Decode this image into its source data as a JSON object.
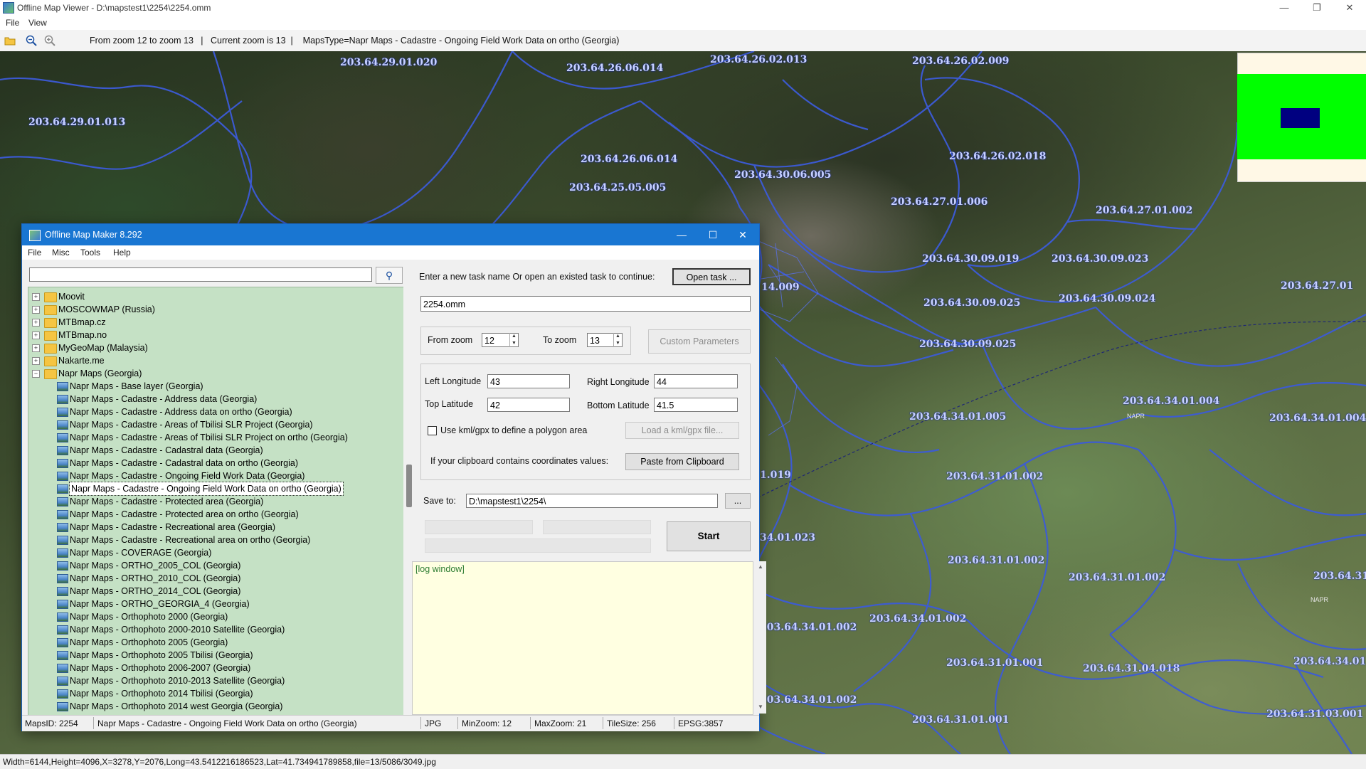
{
  "viewer": {
    "title": "Offline Map Viewer - D:\\mapstest1\\2254\\2254.omm",
    "menu": [
      "File",
      "View"
    ],
    "toolbar_info": "From zoom 12 to zoom 13   |   Current zoom is 13  |    MapsType=Napr Maps - Cadastre - Ongoing Field Work Data on ortho (Georgia)",
    "status": "Width=6144,Height=4096,X=3278,Y=2076,Long=43.5412216186523,Lat=41.734941789858,file=13/5086/3049.jpg",
    "window_controls": [
      "minimize",
      "restore",
      "close"
    ]
  },
  "map": {
    "labels": [
      "203.64.29.01.020",
      "203.64.26.06.014",
      "203.64.26.02.013",
      "203.64.26.02.009",
      "203.64.29.01.013",
      "203.64.26.06.014",
      "203.64.26.02.018",
      "203.64.25.05.005",
      "203.64.30.06.005",
      "203.64.27.01.006",
      "203.64.27.01.002",
      "203.64.30.09.019",
      "203.64.30.09.023",
      "14.009",
      "203.64.27.01",
      "203.64.30.09.025",
      "203.64.30.09.024",
      "203.64.30.09.025",
      "203.64.34.01.004",
      "203.64.34.01.005",
      "203.64.34.01.004",
      "1.019",
      "203.64.31.01.002",
      "34.01.023",
      "203.64.31.01.002",
      "203.64.31.01.002",
      "203.64.31",
      "203.64.34.01.002",
      "203.64.34.01.002",
      "203.64.31.01.001",
      "203.64.31.04.018",
      "203.64.34.01",
      "203.64.34.01.002",
      "203.64.31.01.001",
      "203.64.31.03.001"
    ],
    "small_labels": [
      "NAPR",
      "NAPR"
    ]
  },
  "minimap": {
    "bg": "#fff8e6",
    "area": "#00ff00",
    "view": "#000080"
  },
  "dialog": {
    "title": "Offline Map Maker 8.292",
    "menu": [
      "File",
      "Misc",
      "Tools",
      "Help"
    ],
    "search": {
      "value": "",
      "placeholder": ""
    },
    "tree": [
      {
        "label": "Moovit",
        "type": "folder",
        "expanded": false
      },
      {
        "label": "MOSCOWMAP (Russia)",
        "type": "folder",
        "expanded": false
      },
      {
        "label": "MTBmap.cz",
        "type": "folder",
        "expanded": false
      },
      {
        "label": "MTBmap.no",
        "type": "folder",
        "expanded": false
      },
      {
        "label": "MyGeoMap (Malaysia)",
        "type": "folder",
        "expanded": false
      },
      {
        "label": "Nakarte.me",
        "type": "folder",
        "expanded": false
      },
      {
        "label": "Napr Maps (Georgia)",
        "type": "folder",
        "expanded": true
      },
      {
        "label": "Napr Maps - Base layer (Georgia)",
        "type": "map"
      },
      {
        "label": "Napr Maps - Cadastre - Address data (Georgia)",
        "type": "map"
      },
      {
        "label": "Napr Maps - Cadastre - Address data on ortho (Georgia)",
        "type": "map"
      },
      {
        "label": "Napr Maps - Cadastre - Areas of Tbilisi SLR Project (Georgia)",
        "type": "map"
      },
      {
        "label": "Napr Maps - Cadastre - Areas of Tbilisi SLR Project on ortho (Georgia)",
        "type": "map"
      },
      {
        "label": "Napr Maps - Cadastre - Cadastral data (Georgia)",
        "type": "map"
      },
      {
        "label": "Napr Maps - Cadastre - Cadastral data on ortho (Georgia)",
        "type": "map"
      },
      {
        "label": "Napr Maps - Cadastre - Ongoing Field Work Data (Georgia)",
        "type": "map"
      },
      {
        "label": "Napr Maps - Cadastre - Ongoing Field Work Data on ortho (Georgia)",
        "type": "map",
        "selected": true
      },
      {
        "label": "Napr Maps - Cadastre - Protected area (Georgia)",
        "type": "map"
      },
      {
        "label": "Napr Maps - Cadastre - Protected area on ortho (Georgia)",
        "type": "map"
      },
      {
        "label": "Napr Maps - Cadastre - Recreational area (Georgia)",
        "type": "map"
      },
      {
        "label": "Napr Maps - Cadastre - Recreational area on ortho (Georgia)",
        "type": "map"
      },
      {
        "label": "Napr Maps - COVERAGE (Georgia)",
        "type": "map"
      },
      {
        "label": "Napr Maps - ORTHO_2005_COL (Georgia)",
        "type": "map"
      },
      {
        "label": "Napr Maps - ORTHO_2010_COL (Georgia)",
        "type": "map"
      },
      {
        "label": "Napr Maps - ORTHO_2014_COL (Georgia)",
        "type": "map"
      },
      {
        "label": "Napr Maps - ORTHO_GEORGIA_4 (Georgia)",
        "type": "map"
      },
      {
        "label": "Napr Maps - Orthophoto 2000 (Georgia)",
        "type": "map"
      },
      {
        "label": "Napr Maps - Orthophoto 2000-2010 Satellite (Georgia)",
        "type": "map"
      },
      {
        "label": "Napr Maps - Orthophoto 2005 (Georgia)",
        "type": "map"
      },
      {
        "label": "Napr Maps - Orthophoto 2005 Tbilisi (Georgia)",
        "type": "map"
      },
      {
        "label": "Napr Maps - Orthophoto 2006-2007 (Georgia)",
        "type": "map"
      },
      {
        "label": "Napr Maps - Orthophoto 2010-2013 Satellite (Georgia)",
        "type": "map"
      },
      {
        "label": "Napr Maps - Orthophoto 2014 Tbilisi (Georgia)",
        "type": "map"
      },
      {
        "label": "Napr Maps - Orthophoto 2014 west Georgia (Georgia)",
        "type": "map"
      }
    ],
    "task_prompt": "Enter a new task name Or open an existed task to continue:",
    "open_task_label": "Open task ...",
    "task_name": "2254.omm",
    "from_zoom_label": "From zoom",
    "from_zoom": "12",
    "to_zoom_label": "To zoom",
    "to_zoom": "13",
    "custom_params_label": "Custom Parameters",
    "left_lon_label": "Left Longitude",
    "left_lon": "43",
    "right_lon_label": "Right Longitude",
    "right_lon": "44",
    "top_lat_label": "Top Latitude",
    "top_lat": "42",
    "bottom_lat_label": "Bottom Latitude",
    "bottom_lat": "41.5",
    "kml_label": "Use kml/gpx to define a polygon area",
    "load_kml_label": "Load a kml/gpx file...",
    "clipboard_label": "If your clipboard contains coordinates values:",
    "paste_label": "Paste from Clipboard",
    "save_to_label": "Save to:",
    "save_to": "D:\\mapstest1\\2254\\",
    "browse_label": "...",
    "start_label": "Start",
    "log_text": "[log window]",
    "status": {
      "maps_id": "MapsID: 2254",
      "maps_name": "Napr Maps - Cadastre - Ongoing Field Work Data on ortho (Georgia)",
      "format": "JPG",
      "min_zoom": "MinZoom: 12",
      "max_zoom": "MaxZoom: 21",
      "tile_size": "TileSize: 256",
      "epsg": "EPSG:3857"
    }
  }
}
